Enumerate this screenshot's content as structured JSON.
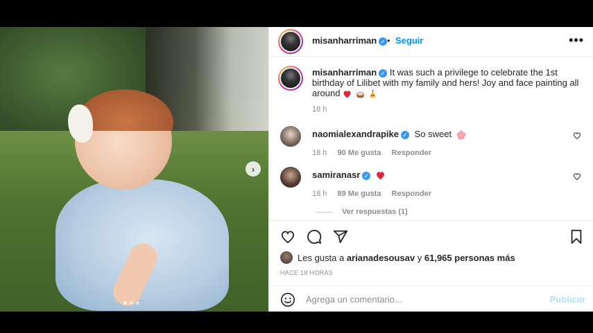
{
  "post": {
    "author": "misanharriman",
    "separator": "•",
    "follow_label": "Seguir",
    "more_label": "•••",
    "caption_text": "It was such a privilege to celebrate the 1st birthday of Lilibet with my family and hers! Joy and face painting all around",
    "caption_time": "18 h",
    "next_label": "›"
  },
  "comments": [
    {
      "user": "naomialexandrapike",
      "text": "So sweet",
      "time": "18 h",
      "likes": "90 Me gusta",
      "reply": "Responder"
    },
    {
      "user": "samiranasr",
      "text": "",
      "time": "18 h",
      "likes": "89 Me gusta",
      "reply": "Responder"
    }
  ],
  "view_replies": "Ver respuestas (1)",
  "likes_line": {
    "prefix": "Les gusta a",
    "user": "arianadesousav",
    "middle": "y",
    "others": "61,965 personas más"
  },
  "timestamp": "HACE 18 HORAS",
  "composer": {
    "placeholder": "Agrega un comentario...",
    "post_label": "Publicar"
  },
  "colors": {
    "accent": "#0095f6",
    "verified": "#3897f0",
    "heart_red": "#ed4956",
    "muted": "#8e8e8e"
  },
  "icons": [
    "verified-icon",
    "more-icon",
    "heart-icon",
    "comment-icon",
    "share-icon",
    "bookmark-icon",
    "smile-icon",
    "chevron-right-icon"
  ]
}
